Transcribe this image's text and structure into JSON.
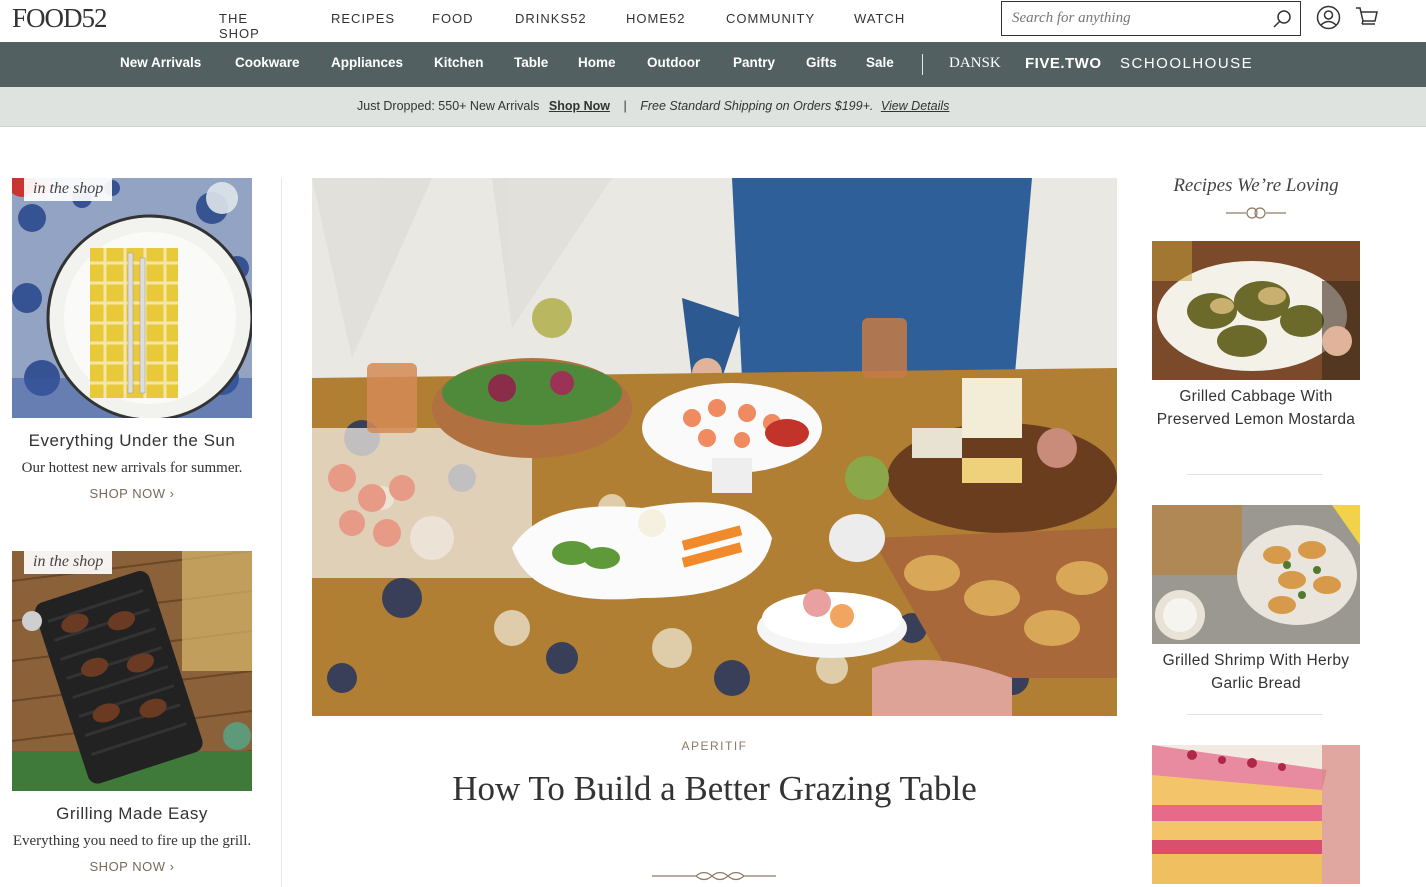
{
  "header": {
    "logo": "FOOD52",
    "nav": [
      "THE SHOP",
      "RECIPES",
      "FOOD",
      "DRINKS52",
      "HOME52",
      "COMMUNITY",
      "WATCH"
    ],
    "search_placeholder": "Search for anything"
  },
  "categories": [
    "New Arrivals",
    "Cookware",
    "Appliances",
    "Kitchen",
    "Table",
    "Home",
    "Outdoor",
    "Pantry",
    "Gifts",
    "Sale"
  ],
  "brands": {
    "dansk": "DANSK",
    "fivetwo": "FIVE.TWO",
    "schoolhouse": "SCHOOLHOUSE"
  },
  "promo": {
    "text1": "Just Dropped: 550+ New Arrivals",
    "shop_now": "Shop Now",
    "separator": "|",
    "text2": "Free Standard Shipping on Orders $199+.",
    "view_details": "View Details"
  },
  "left_cards": [
    {
      "badge": "in the shop",
      "title": "Everything Under the Sun",
      "desc": "Our hottest new arrivals for summer.",
      "cta": "SHOP NOW"
    },
    {
      "badge": "in the shop",
      "title": "Grilling Made Easy",
      "desc": "Everything you need to fire up the grill.",
      "cta": "SHOP NOW"
    }
  ],
  "feature": {
    "kicker": "APERITIF",
    "headline": "How To Build a Better Grazing Table"
  },
  "right_rail": {
    "title": "Recipes We’re Loving",
    "items": [
      {
        "title": "Grilled Cabbage With Preserved Lemon Mostarda"
      },
      {
        "title": "Grilled Shrimp With Herby Garlic Bread"
      },
      {
        "title": ""
      }
    ]
  },
  "colors": {
    "category_bar": "#536062",
    "promo_bar": "#dfe3df",
    "kicker": "#8c7b66"
  }
}
